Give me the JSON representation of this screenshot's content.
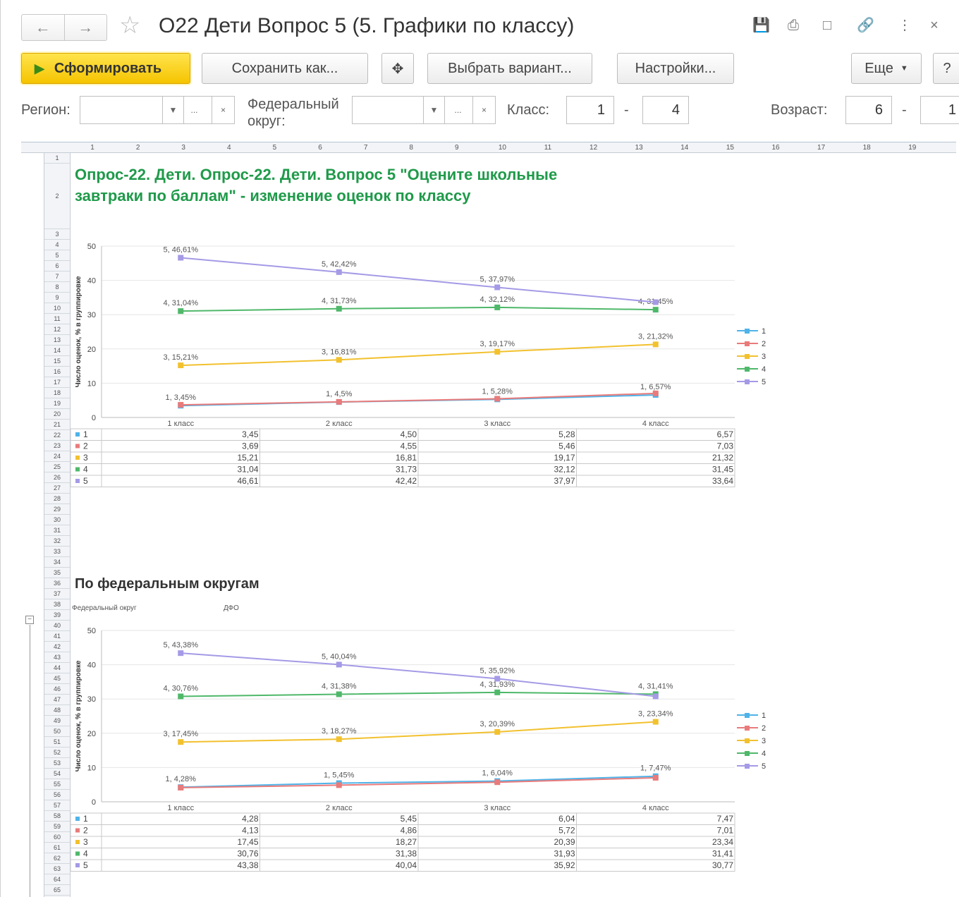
{
  "window": {
    "title": "О22 Дети Вопрос 5 (5. Графики по классу)"
  },
  "toolbar": {
    "generate": "Сформировать",
    "save_as": "Сохранить как...",
    "choose_variant": "Выбрать вариант...",
    "settings": "Настройки...",
    "more": "Еще",
    "help": "?"
  },
  "filters": {
    "region_label": "Регион:",
    "fed_label_line1": "Федеральный",
    "fed_label_line2": "округ:",
    "class_label": "Класс:",
    "class_from": "1",
    "class_to": "4",
    "age_label": "Возраст:",
    "age_from": "6",
    "age_to": "1",
    "dash": "-",
    "dots": "...",
    "clear": "×"
  },
  "column_numbers": [
    "1",
    "2",
    "3",
    "4",
    "5",
    "6",
    "7",
    "8",
    "9",
    "10",
    "11",
    "12",
    "13",
    "14",
    "15",
    "16",
    "17",
    "18",
    "19"
  ],
  "row_numbers": [
    "1",
    "2",
    "3",
    "4",
    "5",
    "6",
    "7",
    "8",
    "9",
    "10",
    "11",
    "12",
    "13",
    "14",
    "15",
    "16",
    "17",
    "18",
    "19",
    "20",
    "21",
    "22",
    "23",
    "24",
    "25",
    "26",
    "27",
    "28",
    "29",
    "30",
    "31",
    "32",
    "33",
    "34",
    "35",
    "36",
    "37",
    "38",
    "39",
    "40",
    "41",
    "42",
    "43",
    "44",
    "45",
    "46",
    "47",
    "48",
    "49",
    "50",
    "51",
    "52",
    "53",
    "54",
    "55",
    "56",
    "57",
    "58",
    "59",
    "60",
    "61",
    "62",
    "63",
    "64",
    "65"
  ],
  "report": {
    "title": "Опрос-22. Дети. Опрос-22. Дети. Вопрос 5 \"Оцените школьные завтраки по баллам\" - изменение оценок по классу",
    "section_title": "По федеральным округам",
    "fed_district_caption": "Федеральный округ",
    "fed_district_value": "ДФО"
  },
  "chart_data": [
    {
      "type": "line",
      "categories": [
        "1 класс",
        "2 класс",
        "3 класс",
        "4 класс"
      ],
      "ylabel": "Число оценок, % в группировке",
      "ylim": [
        0,
        50
      ],
      "yticks": [
        "0",
        "10",
        "20",
        "30",
        "40",
        "50"
      ],
      "legend_position": "right",
      "series": [
        {
          "name": "1",
          "color": "#4fb3e8",
          "values": [
            3.45,
            4.5,
            5.28,
            6.57
          ],
          "labels": [
            "1, 3,45%",
            "1, 4,5%",
            "1, 5,28%",
            "1, 6,57%"
          ]
        },
        {
          "name": "2",
          "color": "#e87b7b",
          "values": [
            3.69,
            4.55,
            5.46,
            7.03
          ],
          "labels": []
        },
        {
          "name": "3",
          "color": "#f2c12e",
          "values": [
            15.21,
            16.81,
            19.17,
            21.32
          ],
          "labels": [
            "3, 15,21%",
            "3, 16,81%",
            "3, 19,17%",
            "3, 21,32%"
          ]
        },
        {
          "name": "4",
          "color": "#4fb86a",
          "values": [
            31.04,
            31.73,
            32.12,
            31.45
          ],
          "labels": [
            "4, 31,04%",
            "4, 31,73%",
            "4, 32,12%",
            "4, 31,45%"
          ]
        },
        {
          "name": "5",
          "color": "#a49ae6",
          "values": [
            46.61,
            42.42,
            37.97,
            33.64
          ],
          "labels": [
            "5, 46,61%",
            "5, 42,42%",
            "5, 37,97%",
            ""
          ]
        }
      ],
      "table": [
        [
          "3,45",
          "4,50",
          "5,28",
          "6,57"
        ],
        [
          "3,69",
          "4,55",
          "5,46",
          "7,03"
        ],
        [
          "15,21",
          "16,81",
          "19,17",
          "21,32"
        ],
        [
          "31,04",
          "31,73",
          "32,12",
          "31,45"
        ],
        [
          "46,61",
          "42,42",
          "37,97",
          "33,64"
        ]
      ]
    },
    {
      "type": "line",
      "categories": [
        "1 класс",
        "2 класс",
        "3 класс",
        "4 класс"
      ],
      "ylabel": "Число оценок, % в группировке",
      "ylim": [
        0,
        50
      ],
      "yticks": [
        "0",
        "10",
        "20",
        "30",
        "40",
        "50"
      ],
      "legend_position": "right",
      "series": [
        {
          "name": "1",
          "color": "#4fb3e8",
          "values": [
            4.28,
            5.45,
            6.04,
            7.47
          ],
          "labels": [
            "1, 4,28%",
            "1, 5,45%",
            "1, 6,04%",
            "1, 7,47%"
          ]
        },
        {
          "name": "2",
          "color": "#e87b7b",
          "values": [
            4.13,
            4.86,
            5.72,
            7.01
          ],
          "labels": []
        },
        {
          "name": "3",
          "color": "#f2c12e",
          "values": [
            17.45,
            18.27,
            20.39,
            23.34
          ],
          "labels": [
            "3, 17,45%",
            "3, 18,27%",
            "3, 20,39%",
            "3, 23,34%"
          ]
        },
        {
          "name": "4",
          "color": "#4fb86a",
          "values": [
            30.76,
            31.38,
            31.93,
            31.41
          ],
          "labels": [
            "4, 30,76%",
            "4, 31,38%",
            "4, 31,93%",
            "4, 31,41%"
          ]
        },
        {
          "name": "5",
          "color": "#a49ae6",
          "values": [
            43.38,
            40.04,
            35.92,
            30.77
          ],
          "labels": [
            "5, 43,38%",
            "5, 40,04%",
            "5, 35,92%",
            ""
          ]
        }
      ],
      "table": [
        [
          "4,28",
          "5,45",
          "6,04",
          "7,47"
        ],
        [
          "4,13",
          "4,86",
          "5,72",
          "7,01"
        ],
        [
          "17,45",
          "18,27",
          "20,39",
          "23,34"
        ],
        [
          "30,76",
          "31,38",
          "31,93",
          "31,41"
        ],
        [
          "43,38",
          "40,04",
          "35,92",
          "30,77"
        ]
      ]
    }
  ]
}
